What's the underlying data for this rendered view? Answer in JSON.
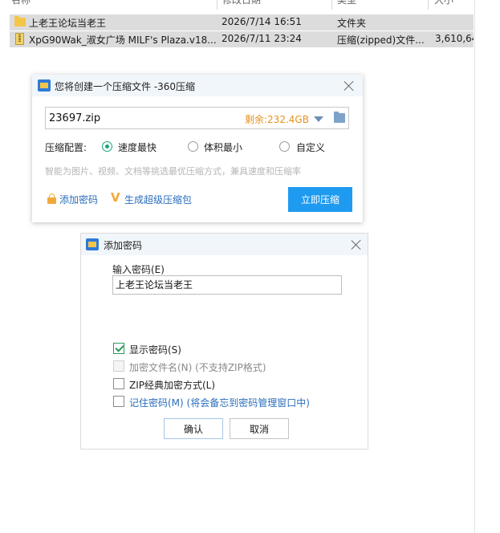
{
  "file_list": {
    "columns": [
      "名称",
      "修改日期",
      "类型",
      "大小"
    ],
    "rows": [
      {
        "icon": "folder-icon",
        "name": "上老王论坛当老王",
        "date": "2026/7/14 16:51",
        "type": "文件夹",
        "size": ""
      },
      {
        "icon": "zip-icon",
        "name": "XpG90Wak_淑女广场 MILF's Plaza.v18...",
        "date": "2026/7/11 23:24",
        "type": "压缩(zipped)文件...",
        "size": "3,610,64"
      }
    ]
  },
  "compress_dialog": {
    "title": "您将创建一个压缩文件 -360压缩",
    "path_value": "23697.zip",
    "free_space": "剩余:232.4GB",
    "config_label": "压缩配置:",
    "options": [
      {
        "label": "速度最快",
        "selected": true
      },
      {
        "label": "体积最小",
        "selected": false
      },
      {
        "label": "自定义",
        "selected": false
      }
    ],
    "hint": "智能为图片、视频、文档等挑选最优压缩方式，兼具速度和压缩率",
    "add_password_link": "添加密码",
    "super_compress_link": "生成超级压缩包",
    "compress_button": "立即压缩",
    "accent_color": "#1e9bf0"
  },
  "password_dialog": {
    "title": "添加密码",
    "input_label": "输入密码(E)",
    "password_value": "上老王论坛当老王",
    "checkboxes": [
      {
        "label": "显示密码(S)",
        "checked": true,
        "disabled": false
      },
      {
        "label": "加密文件名(N) (不支持ZIP格式)",
        "checked": false,
        "disabled": true
      },
      {
        "label": "ZIP经典加密方式(L)",
        "checked": false,
        "disabled": false
      },
      {
        "label": "记住密码(M) (将会备忘到密码管理窗口中)",
        "checked": false,
        "disabled": false
      }
    ],
    "ok_button": "确认",
    "cancel_button": "取消"
  }
}
